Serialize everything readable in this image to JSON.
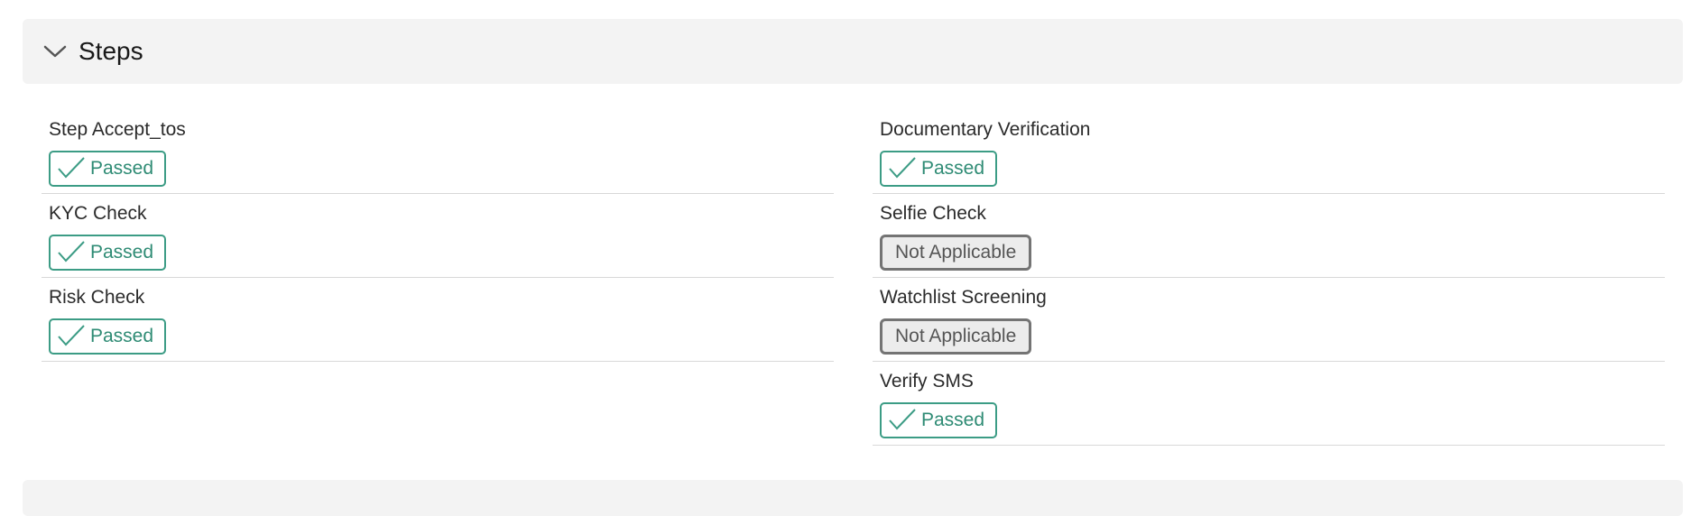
{
  "section": {
    "title": "Steps",
    "chevron_icon": "chevron-down-icon"
  },
  "steps_left": [
    {
      "label": "Step Accept_tos",
      "status": "Passed",
      "status_type": "passed"
    },
    {
      "label": "KYC Check",
      "status": "Passed",
      "status_type": "passed"
    },
    {
      "label": "Risk Check",
      "status": "Passed",
      "status_type": "passed"
    }
  ],
  "steps_right": [
    {
      "label": "Documentary Verification",
      "status": "Passed",
      "status_type": "passed"
    },
    {
      "label": "Selfie Check",
      "status": "Not Applicable",
      "status_type": "na"
    },
    {
      "label": "Watchlist Screening",
      "status": "Not Applicable",
      "status_type": "na"
    },
    {
      "label": "Verify SMS",
      "status": "Passed",
      "status_type": "passed"
    }
  ],
  "colors": {
    "passed": "#3c9c85",
    "not_applicable": "#747474",
    "header_bg": "#f3f3f3"
  }
}
